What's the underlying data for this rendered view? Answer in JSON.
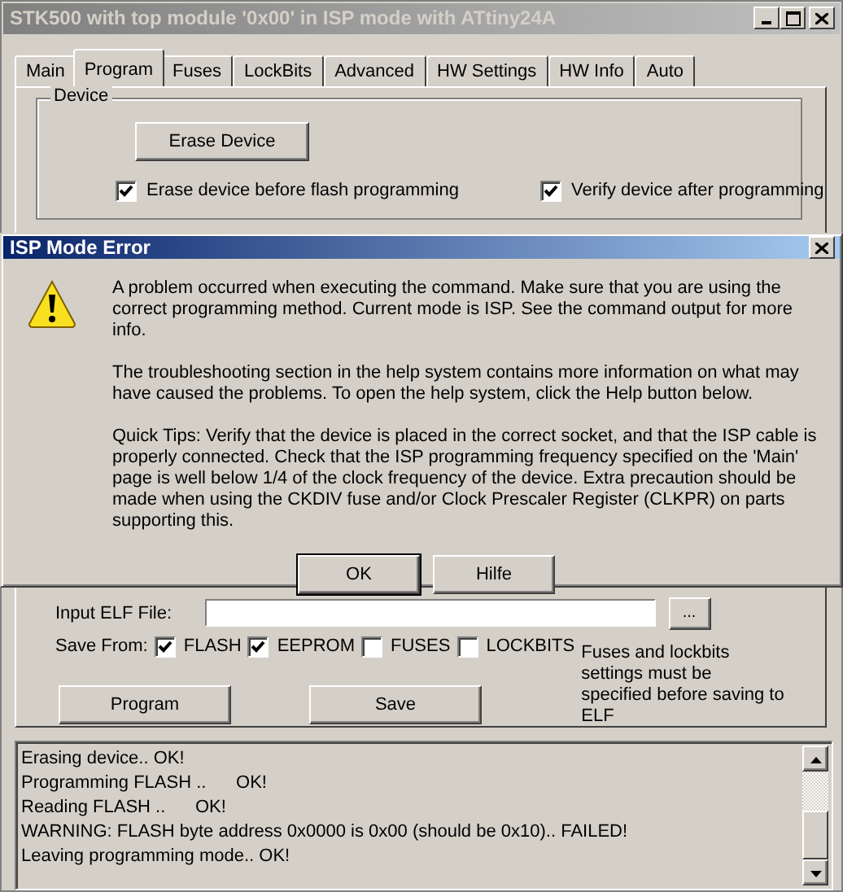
{
  "window": {
    "title": "STK500 with top module '0x00' in ISP mode with ATtiny24A"
  },
  "tabs": [
    {
      "label": "Main",
      "selected": false
    },
    {
      "label": "Program",
      "selected": true
    },
    {
      "label": "Fuses",
      "selected": false
    },
    {
      "label": "LockBits",
      "selected": false
    },
    {
      "label": "Advanced",
      "selected": false
    },
    {
      "label": "HW Settings",
      "selected": false
    },
    {
      "label": "HW Info",
      "selected": false
    },
    {
      "label": "Auto",
      "selected": false
    }
  ],
  "device": {
    "legend": "Device",
    "erase_button": "Erase Device",
    "options": [
      {
        "label": "Erase device before flash programming",
        "checked": true
      },
      {
        "label": "Verify device after programming",
        "checked": true
      }
    ]
  },
  "elf": {
    "input_label": "Input ELF File:",
    "browse_button": "...",
    "save_from_label": "Save From:",
    "sources": [
      {
        "label": "FLASH",
        "checked": true
      },
      {
        "label": "EEPROM",
        "checked": true
      },
      {
        "label": "FUSES",
        "checked": false
      },
      {
        "label": "LOCKBITS",
        "checked": false
      }
    ],
    "note": "Fuses and lockbits settings must be specified before saving to ELF",
    "program_button": "Program",
    "save_button": "Save"
  },
  "log": [
    "Erasing device.. OK!",
    "Programming FLASH ..      OK!",
    "Reading FLASH ..      OK!",
    "WARNING: FLASH byte address 0x0000 is 0x00 (should be 0x10).. FAILED!",
    "Leaving programming mode.. OK!"
  ],
  "dialog": {
    "title": "ISP Mode Error",
    "paragraphs": [
      "A problem occurred when executing the command. Make sure that you are using the correct programming method. Current mode is ISP. See the command output for more info.",
      "The troubleshooting section in the help system contains more information on what may have caused the problems. To open the help system, click the Help button below.",
      "Quick Tips: Verify that the device is placed in the correct socket, and that the ISP cable is properly connected. Check that the ISP programming frequency specified on the 'Main' page is well below 1/4 of the clock frequency of the device. Extra precaution should be made when using the CKDIV fuse and/or Clock Prescaler Register (CLKPR) on parts supporting this."
    ],
    "buttons": [
      "OK",
      "Hilfe"
    ]
  }
}
